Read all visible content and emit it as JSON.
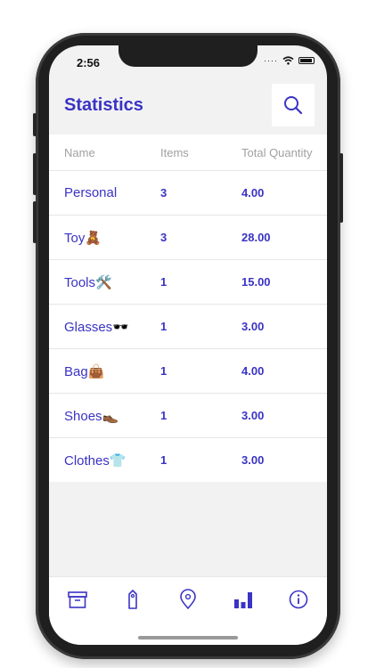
{
  "status_bar": {
    "time": "2:56"
  },
  "header": {
    "title": "Statistics"
  },
  "table": {
    "columns": [
      "Name",
      "Items",
      "Total Quantity"
    ],
    "rows": [
      {
        "name": "Personal",
        "items": "3",
        "total": "4.00"
      },
      {
        "name": "Toy🧸",
        "items": "3",
        "total": "28.00"
      },
      {
        "name": "Tools🛠️",
        "items": "1",
        "total": "15.00"
      },
      {
        "name": "Glasses🕶️",
        "items": "1",
        "total": "3.00"
      },
      {
        "name": "Bag👜",
        "items": "1",
        "total": "4.00"
      },
      {
        "name": "Shoes👞",
        "items": "1",
        "total": "3.00"
      },
      {
        "name": "Clothes👕",
        "items": "1",
        "total": "3.00"
      }
    ]
  },
  "tabbar": {
    "tabs": [
      {
        "icon": "archive-box-icon",
        "active": false
      },
      {
        "icon": "tag-icon",
        "active": false
      },
      {
        "icon": "location-pin-icon",
        "active": false
      },
      {
        "icon": "bar-chart-icon",
        "active": true
      },
      {
        "icon": "info-icon",
        "active": false
      }
    ]
  },
  "colors": {
    "accent": "#3a33c4",
    "muted": "#a0a0a0",
    "background": "#f2f2f2"
  }
}
